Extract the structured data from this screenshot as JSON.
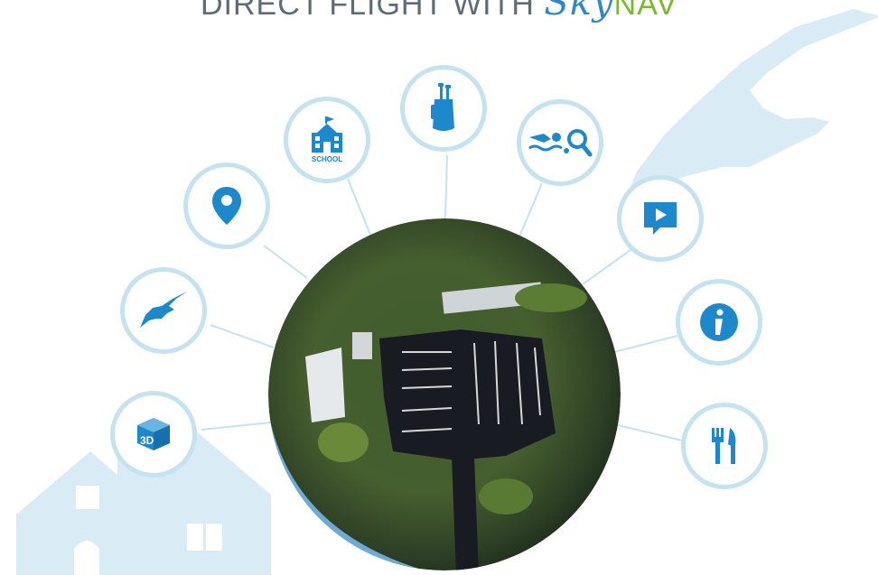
{
  "header": {
    "title_prefix": "DIRECT FLIGHT WITH ",
    "brand_part1": "Sky",
    "brand_part2": "NAV"
  },
  "hub": {
    "name": "marina-aerial-globe"
  },
  "nodes": [
    {
      "id": "3d-view",
      "icon": "3d-cube-icon"
    },
    {
      "id": "flyover",
      "icon": "bird-icon"
    },
    {
      "id": "location",
      "icon": "map-pin-icon"
    },
    {
      "id": "school",
      "icon": "school-icon",
      "label": "SCHOOL"
    },
    {
      "id": "golf",
      "icon": "golf-bag-icon"
    },
    {
      "id": "recreation",
      "icon": "swim-tennis-icon"
    },
    {
      "id": "video",
      "icon": "video-play-icon"
    },
    {
      "id": "info",
      "icon": "info-icon"
    },
    {
      "id": "dining",
      "icon": "fork-knife-icon"
    }
  ],
  "colors": {
    "accent": "#1e88cc",
    "ring": "#c4e2f0",
    "decor": "#d9ebf5",
    "title": "#5d6b78",
    "brand_blue": "#2e87c8",
    "brand_green": "#7ab82f"
  }
}
